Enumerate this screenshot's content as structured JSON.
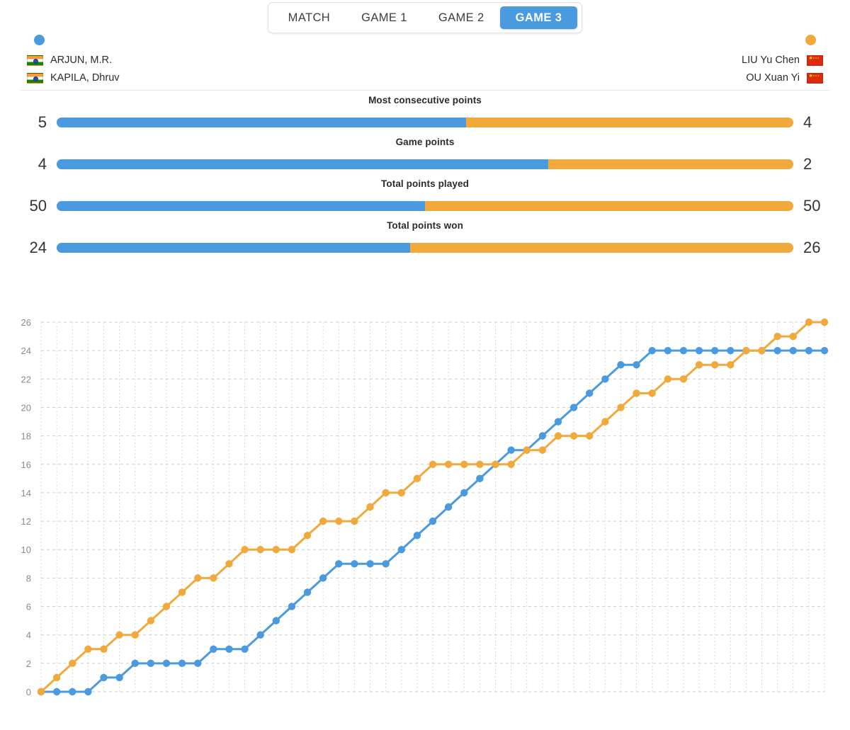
{
  "tabs": [
    {
      "label": "MATCH",
      "active": false
    },
    {
      "label": "GAME 1",
      "active": false
    },
    {
      "label": "GAME 2",
      "active": false
    },
    {
      "label": "GAME 3",
      "active": true
    }
  ],
  "teams": {
    "left": {
      "color": "#4a9ae0",
      "players": [
        {
          "name": "ARJUN, M.R.",
          "flag": "india-flag"
        },
        {
          "name": "KAPILA, Dhruv",
          "flag": "india-flag"
        }
      ]
    },
    "right": {
      "color": "#f0a93a",
      "players": [
        {
          "name": "LIU Yu Chen",
          "flag": "china-flag"
        },
        {
          "name": "OU Xuan Yi",
          "flag": "china-flag"
        }
      ]
    }
  },
  "stats": [
    {
      "label": "Most consecutive points",
      "left": "5",
      "right": "4",
      "left_pct": 55.6
    },
    {
      "label": "Game points",
      "left": "4",
      "right": "2",
      "left_pct": 66.7
    },
    {
      "label": "Total points played",
      "left": "50",
      "right": "50",
      "left_pct": 50.0
    },
    {
      "label": "Total points won",
      "left": "24",
      "right": "26",
      "left_pct": 48.0
    }
  ],
  "chart_data": {
    "type": "line",
    "title": "",
    "xlabel": "",
    "ylabel": "",
    "ylim": [
      0,
      26
    ],
    "yticks": [
      0,
      2,
      4,
      6,
      8,
      10,
      12,
      14,
      16,
      18,
      20,
      22,
      24,
      26
    ],
    "xlim": [
      0,
      50
    ],
    "grid": true,
    "legend_position": "top",
    "rally_count": 50,
    "series": [
      {
        "name": "ARJUN, M.R. / KAPILA, Dhruv",
        "color": "#4a9ae0",
        "final": 24,
        "values": [
          0,
          0,
          0,
          0,
          1,
          1,
          2,
          2,
          2,
          2,
          2,
          3,
          3,
          3,
          4,
          5,
          6,
          7,
          8,
          9,
          9,
          9,
          9,
          10,
          11,
          12,
          13,
          14,
          15,
          16,
          17,
          17,
          18,
          19,
          20,
          21,
          22,
          23,
          23,
          24,
          24,
          24,
          24,
          24,
          24,
          24,
          24,
          24,
          24,
          24,
          24
        ]
      },
      {
        "name": "LIU Yu Chen / OU Xuan Yi",
        "color": "#f0a93a",
        "final": 26,
        "values": [
          0,
          1,
          2,
          3,
          3,
          4,
          4,
          5,
          6,
          7,
          8,
          8,
          9,
          10,
          10,
          10,
          10,
          11,
          12,
          12,
          12,
          13,
          14,
          14,
          15,
          16,
          16,
          16,
          16,
          16,
          16,
          17,
          17,
          18,
          18,
          18,
          19,
          20,
          21,
          21,
          22,
          22,
          23,
          23,
          23,
          24,
          24,
          25,
          25,
          26,
          26
        ]
      }
    ]
  }
}
